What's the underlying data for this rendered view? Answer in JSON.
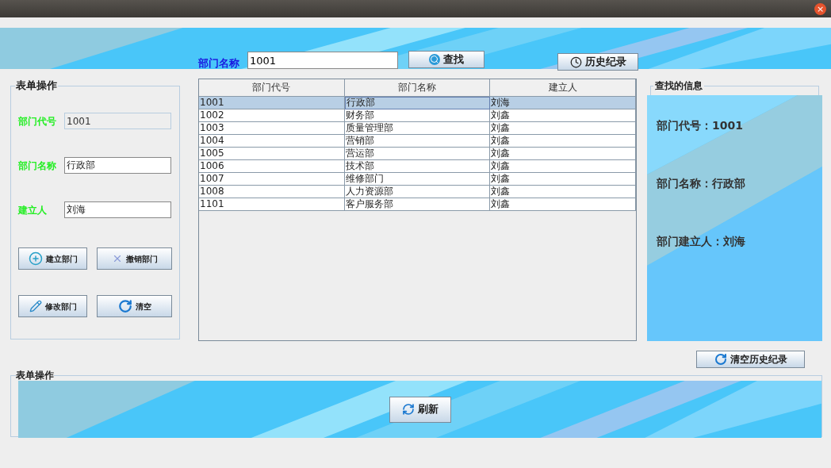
{
  "title_bar": {
    "close": "×"
  },
  "search": {
    "label": "部门名称",
    "value": "1001",
    "button": "查找",
    "history_button": "历史纪录"
  },
  "form": {
    "title": "表单操作",
    "fields": [
      {
        "label": "部门代号",
        "value": "1001",
        "disabled": true
      },
      {
        "label": "部门名称",
        "value": "行政部",
        "disabled": false
      },
      {
        "label": "建立人",
        "value": "刘海",
        "disabled": false
      }
    ],
    "buttons": [
      {
        "kind": "add",
        "label": "建立部门"
      },
      {
        "kind": "cancel",
        "label": "撤销部门"
      },
      {
        "kind": "edit",
        "label": "修改部门"
      },
      {
        "kind": "clear",
        "label": "清空"
      }
    ]
  },
  "table": {
    "columns": [
      "部门代号",
      "部门名称",
      "建立人"
    ],
    "rows": [
      {
        "selected": true,
        "cells": [
          {
            "text": "1001",
            "focused": false
          },
          {
            "text": "行政部",
            "focused": true
          },
          {
            "text": "刘海",
            "focused": false
          }
        ]
      },
      {
        "selected": false,
        "cells": [
          {
            "text": "1002",
            "focused": false
          },
          {
            "text": "财务部",
            "focused": false
          },
          {
            "text": "刘鑫",
            "focused": false
          }
        ]
      },
      {
        "selected": false,
        "cells": [
          {
            "text": "1003",
            "focused": false
          },
          {
            "text": "质量管理部",
            "focused": false
          },
          {
            "text": "刘鑫",
            "focused": false
          }
        ]
      },
      {
        "selected": false,
        "cells": [
          {
            "text": "1004",
            "focused": false
          },
          {
            "text": "营销部",
            "focused": false
          },
          {
            "text": "刘鑫",
            "focused": false
          }
        ]
      },
      {
        "selected": false,
        "cells": [
          {
            "text": "1005",
            "focused": false
          },
          {
            "text": "营运部",
            "focused": false
          },
          {
            "text": "刘鑫",
            "focused": false
          }
        ]
      },
      {
        "selected": false,
        "cells": [
          {
            "text": "1006",
            "focused": false
          },
          {
            "text": "技术部",
            "focused": false
          },
          {
            "text": "刘鑫",
            "focused": false
          }
        ]
      },
      {
        "selected": false,
        "cells": [
          {
            "text": "1007",
            "focused": false
          },
          {
            "text": "维修部门",
            "focused": false
          },
          {
            "text": "刘鑫",
            "focused": false
          }
        ]
      },
      {
        "selected": false,
        "cells": [
          {
            "text": "1008",
            "focused": false
          },
          {
            "text": "人力资源部",
            "focused": false
          },
          {
            "text": "刘鑫",
            "focused": false
          }
        ]
      },
      {
        "selected": false,
        "cells": [
          {
            "text": "1101",
            "focused": false
          },
          {
            "text": "客户服务部",
            "focused": false
          },
          {
            "text": "刘鑫",
            "focused": false
          }
        ]
      }
    ]
  },
  "info": {
    "title": "查找的信息",
    "lines": [
      "部门代号：1001",
      "部门名称：行政部",
      "部门建立人：刘海"
    ]
  },
  "clear_history_button": "清空历史纪录",
  "bottom": {
    "title": "表单操作",
    "refresh_button": "刷新"
  }
}
